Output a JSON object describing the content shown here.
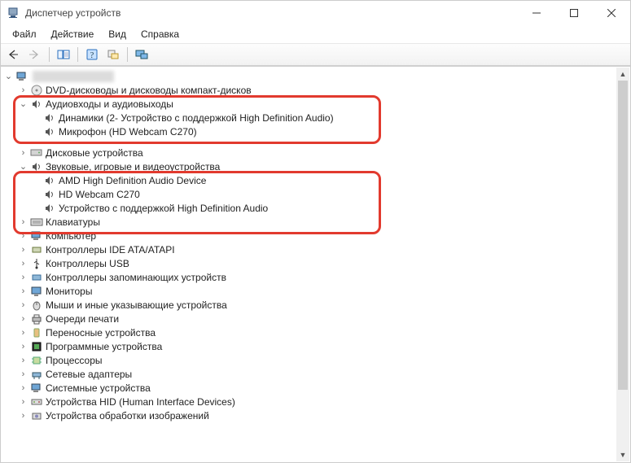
{
  "window": {
    "title": "Диспетчер устройств"
  },
  "menu": {
    "file": "Файл",
    "action": "Действие",
    "view": "Вид",
    "help": "Справка"
  },
  "tree": {
    "root": "",
    "cat_dvd": "DVD-дисководы и дисководы компакт-дисков",
    "cat_audio_io": "Аудиовходы и аудиовыходы",
    "dev_speakers": "Динамики (2- Устройство с поддержкой High Definition Audio)",
    "dev_mic": "Микрофон (HD Webcam C270)",
    "cat_disk": "Дисковые устройства",
    "cat_sound": "Звуковые, игровые и видеоустройства",
    "dev_amd": "AMD High Definition Audio Device",
    "dev_webcam": "HD Webcam C270",
    "dev_hda": "Устройство с поддержкой High Definition Audio",
    "cat_kbd": "Клавиатуры",
    "cat_computer": "Компьютер",
    "cat_ide": "Контроллеры IDE ATA/ATAPI",
    "cat_usb": "Контроллеры USB",
    "cat_storage": "Контроллеры запоминающих устройств",
    "cat_monitor": "Мониторы",
    "cat_mouse": "Мыши и иные указывающие устройства",
    "cat_print": "Очереди печати",
    "cat_portable": "Переносные устройства",
    "cat_software": "Программные устройства",
    "cat_cpu": "Процессоры",
    "cat_net": "Сетевые адаптеры",
    "cat_sys": "Системные устройства",
    "cat_hid": "Устройства HID (Human Interface Devices)",
    "cat_imaging": "Устройства обработки изображений"
  }
}
